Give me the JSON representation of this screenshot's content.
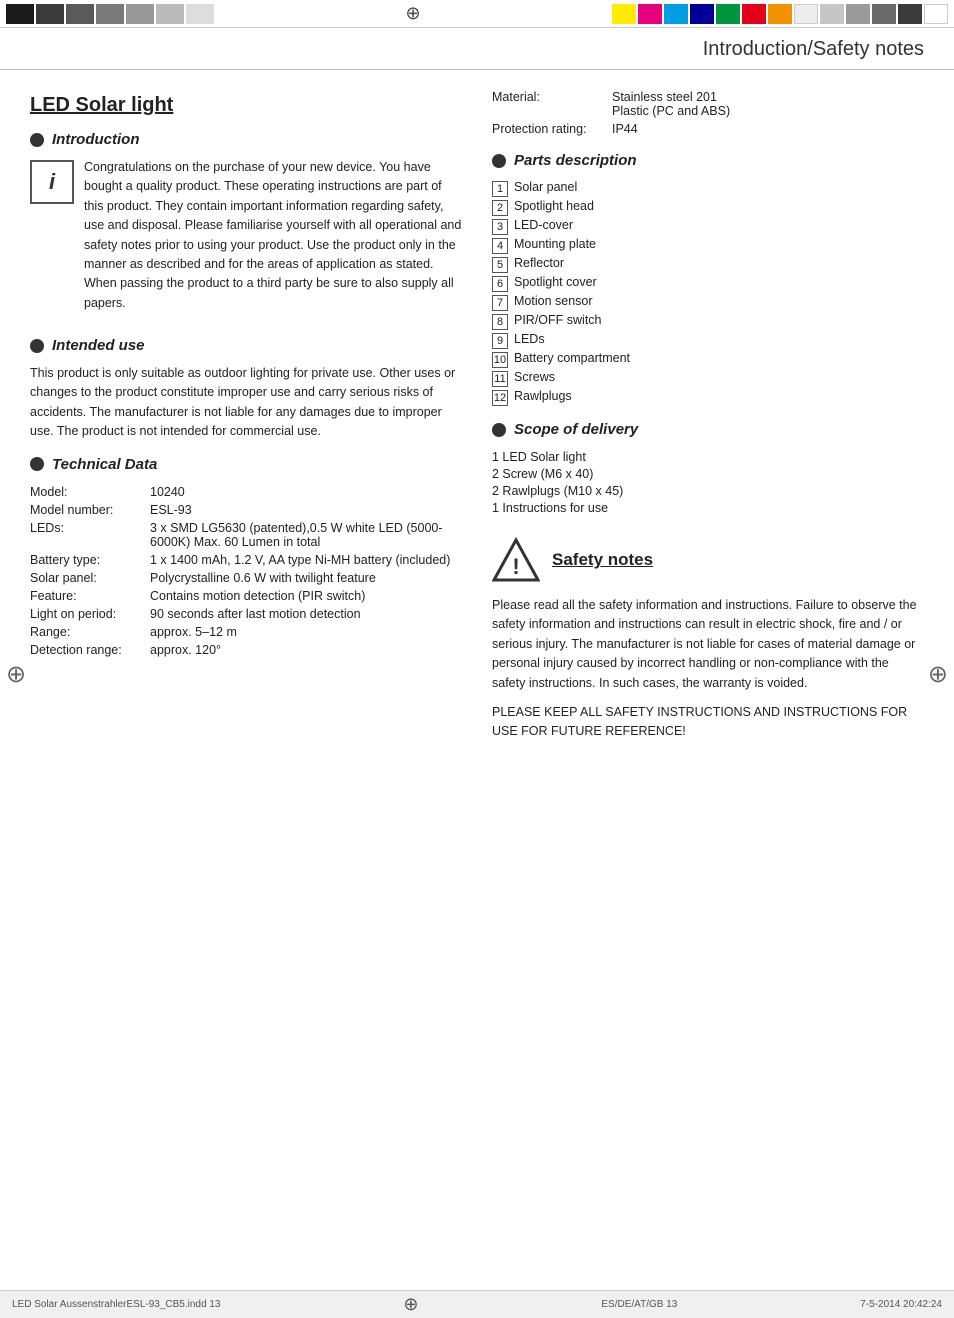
{
  "topBar": {
    "blacks": [
      "#1a1a1a",
      "#3a3a3a",
      "#5a5a5a",
      "#7a7a7a",
      "#999",
      "#bbb",
      "#ddd"
    ],
    "rightColors": [
      "#ffec00",
      "#e6007e",
      "#009fe3",
      "#000099",
      "#009640",
      "#e2001a",
      "#f39200",
      "#ececec",
      "#c6c6c6",
      "#9a9a9a"
    ]
  },
  "pageHeader": {
    "title": "Introduction/Safety notes"
  },
  "leftCol": {
    "productTitle": "LED Solar light",
    "introSection": {
      "heading": "Introduction",
      "iconSymbol": "i",
      "bodyText": "Congratulations on the purchase of your new device. You have bought a quality product. These operating instructions are part of this product. They contain important information regarding safety, use and disposal. Please familiarise yourself with all operational and safety notes prior to using your product. Use the product only in the manner as described and for the areas of application as stated. When passing the product to a third party be sure to also supply all papers."
    },
    "intendedUseSection": {
      "heading": "Intended use",
      "bodyText": "This product is only suitable as outdoor lighting for private use. Other uses or changes to the product constitute improper use and carry serious risks of accidents. The manufacturer is not liable for any damages due to improper use. The product is not intended for commercial use."
    },
    "technicalDataSection": {
      "heading": "Technical Data",
      "rows": [
        {
          "label": "Model:",
          "value": "10240"
        },
        {
          "label": "Model number:",
          "value": "ESL-93"
        },
        {
          "label": "LEDs:",
          "value": "3 x SMD LG5630 (patented),0.5 W white LED (5000-6000K) Max. 60 Lumen in total"
        },
        {
          "label": "Battery type:",
          "value": "1 x 1400 mAh, 1.2 V, AA type Ni-MH battery (included)"
        },
        {
          "label": "Solar panel:",
          "value": "Polycrystalline 0.6 W with twilight feature"
        },
        {
          "label": "Feature:",
          "value": "Contains motion detection (PIR switch)"
        },
        {
          "label": "Light on period:",
          "value": "90 seconds after last motion detection"
        },
        {
          "label": "Range:",
          "value": "approx. 5–12 m"
        },
        {
          "label": "Detection range:",
          "value": "approx. 120°"
        }
      ]
    }
  },
  "rightCol": {
    "specRows": [
      {
        "label": "Material:",
        "value": "Stainless steel 201\nPlastic (PC and ABS)"
      },
      {
        "label": "Protection rating:",
        "value": "IP44"
      }
    ],
    "partsSection": {
      "heading": "Parts description",
      "items": [
        {
          "num": "1",
          "label": "Solar panel"
        },
        {
          "num": "2",
          "label": "Spotlight head"
        },
        {
          "num": "3",
          "label": "LED-cover"
        },
        {
          "num": "4",
          "label": "Mounting plate"
        },
        {
          "num": "5",
          "label": "Reflector"
        },
        {
          "num": "6",
          "label": "Spotlight cover"
        },
        {
          "num": "7",
          "label": "Motion sensor"
        },
        {
          "num": "8",
          "label": "PIR/OFF switch"
        },
        {
          "num": "9",
          "label": "LEDs"
        },
        {
          "num": "10",
          "label": "Battery compartment"
        },
        {
          "num": "11",
          "label": "Screws"
        },
        {
          "num": "12",
          "label": "Rawlplugs"
        }
      ]
    },
    "scopeSection": {
      "heading": "Scope of delivery",
      "items": [
        "1 LED Solar light",
        "2 Screw (M6 x 40)",
        "2 Rawlplugs (M10 x 45)",
        "1 Instructions for use"
      ]
    },
    "safetySection": {
      "heading": "Safety notes",
      "bodyText1": "Please read all the safety information and instructions. Failure to observe the safety information and instructions can result in electric shock, fire and / or serious injury. The manufacturer is not liable for cases of material damage or personal injury caused by incorrect handling or non-compliance with the safety instructions. In such cases, the warranty is voided.",
      "bodyText2": "PLEASE KEEP ALL SAFETY INSTRUCTIONS AND INSTRUCTIONS FOR USE FOR FUTURE REFERENCE!"
    }
  },
  "footer": {
    "leftText": "LED Solar AussenstrahlerESL-93_CB5.indd   13",
    "crosshair": "⊕",
    "rightText": "7-5-2014   20:42:24",
    "pageInfo": "ES/DE/AT/GB    13"
  }
}
